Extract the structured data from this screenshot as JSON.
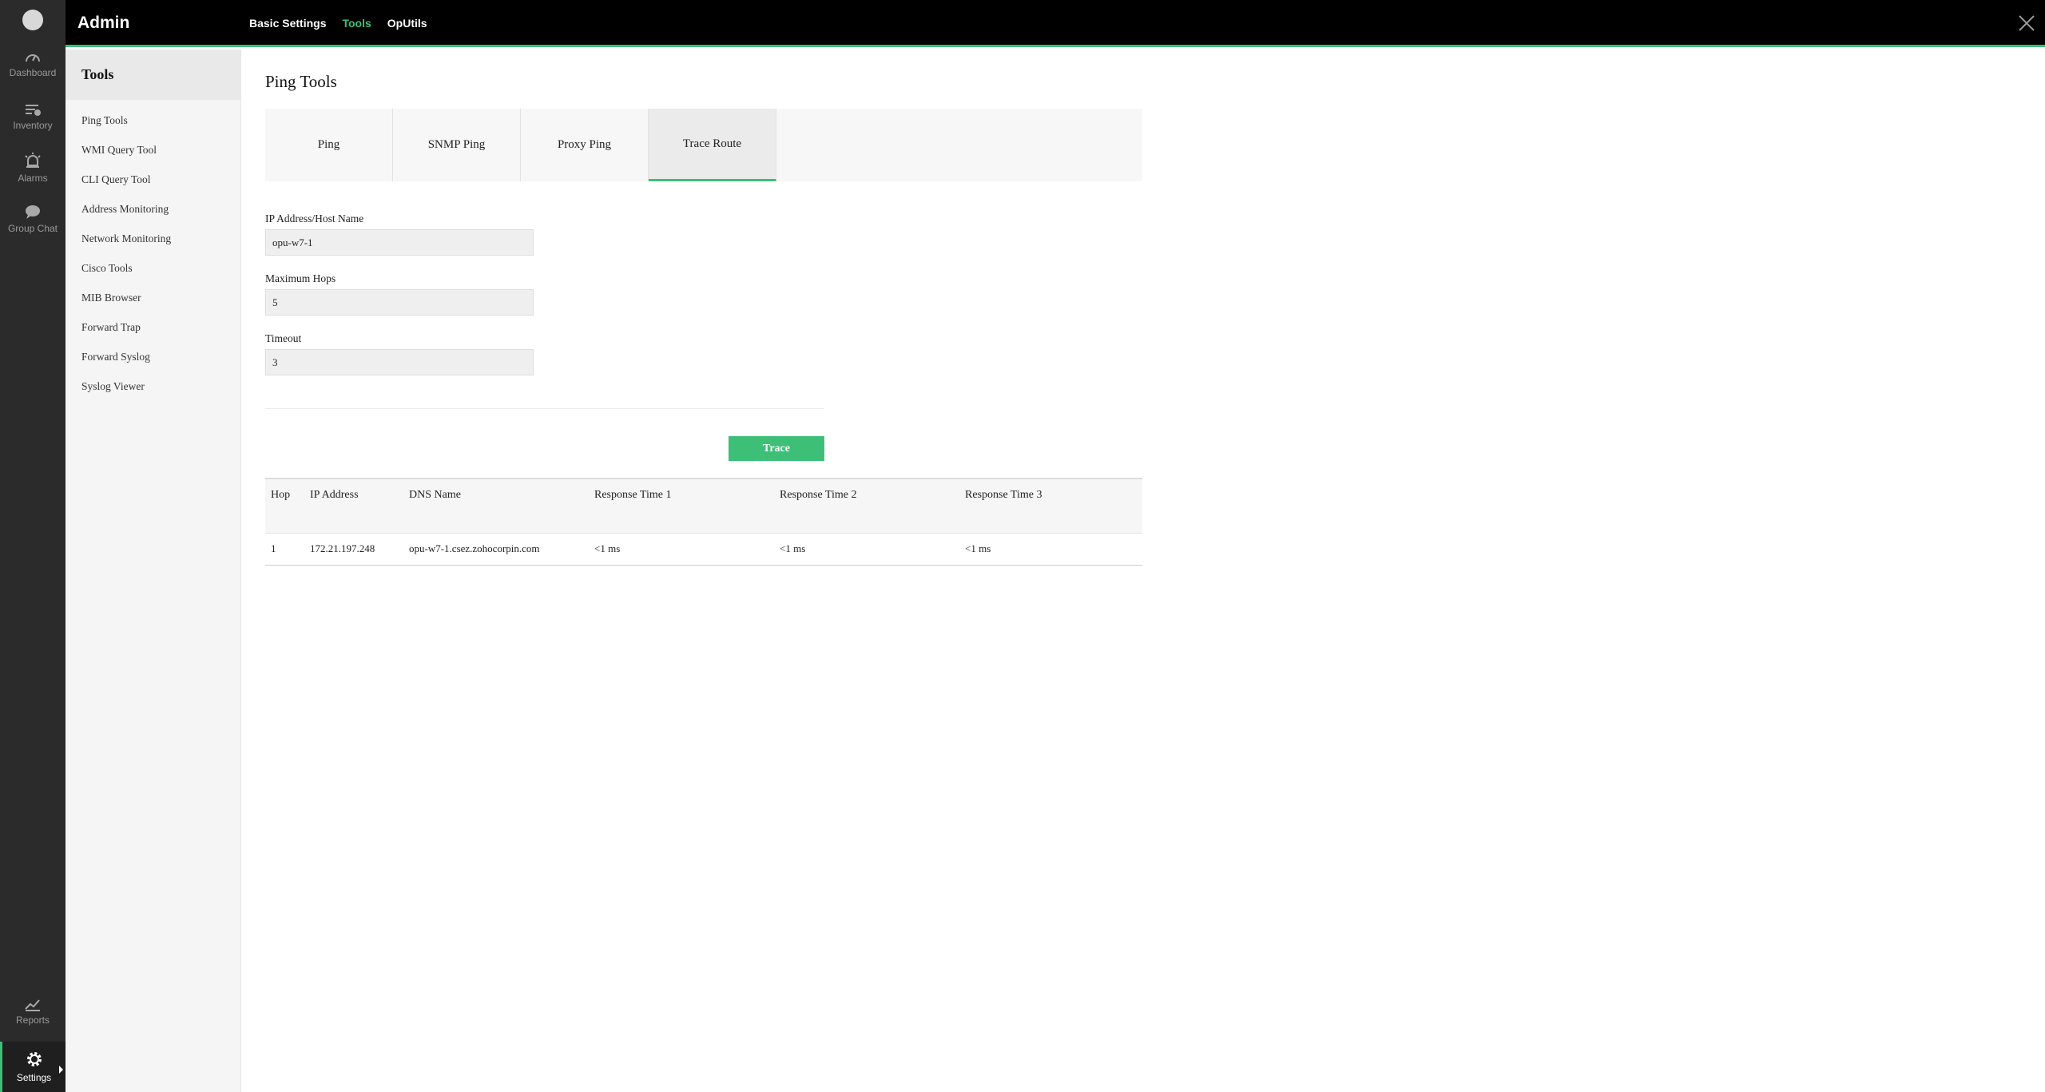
{
  "rail": {
    "items": [
      {
        "label": "Dashboard",
        "icon": "gauge-icon"
      },
      {
        "label": "Inventory",
        "icon": "inventory-icon"
      },
      {
        "label": "Alarms",
        "icon": "alarm-icon"
      },
      {
        "label": "Group Chat",
        "icon": "chat-icon"
      }
    ],
    "bottom": [
      {
        "label": "Reports",
        "icon": "reports-icon"
      },
      {
        "label": "Settings",
        "icon": "gear-icon"
      }
    ]
  },
  "topbar": {
    "title": "Admin",
    "nav": [
      "Basic Settings",
      "Tools",
      "OpUtils"
    ],
    "active_nav": "Tools"
  },
  "sidebar": {
    "heading": "Tools",
    "items": [
      "Ping Tools",
      "WMI Query Tool",
      "CLI Query Tool",
      "Address Monitoring",
      "Network Monitoring",
      "Cisco Tools",
      "MIB Browser",
      "Forward Trap",
      "Forward Syslog",
      "Syslog Viewer"
    ]
  },
  "main": {
    "title": "Ping Tools",
    "tabs": [
      "Ping",
      "SNMP Ping",
      "Proxy Ping",
      "Trace Route"
    ],
    "active_tab": "Trace Route",
    "fields": [
      {
        "label": "IP Address/Host Name",
        "value": "opu-w7-1"
      },
      {
        "label": "Maximum Hops",
        "value": "5"
      },
      {
        "label": "Timeout",
        "value": "3"
      }
    ],
    "trace_label": "Trace",
    "table": {
      "headers": [
        "Hop",
        "IP Address",
        "DNS Name",
        "Response Time 1",
        "Response Time 2",
        "Response Time 3"
      ],
      "rows": [
        [
          "1",
          "172.21.197.248",
          "opu-w7-1.csez.zohocorpin.com",
          "<1 ms",
          "<1 ms",
          "<1 ms"
        ]
      ]
    }
  },
  "colors": {
    "accent": "#3dbf78",
    "topbar": "#000000",
    "rail": "#2b2b2b"
  }
}
